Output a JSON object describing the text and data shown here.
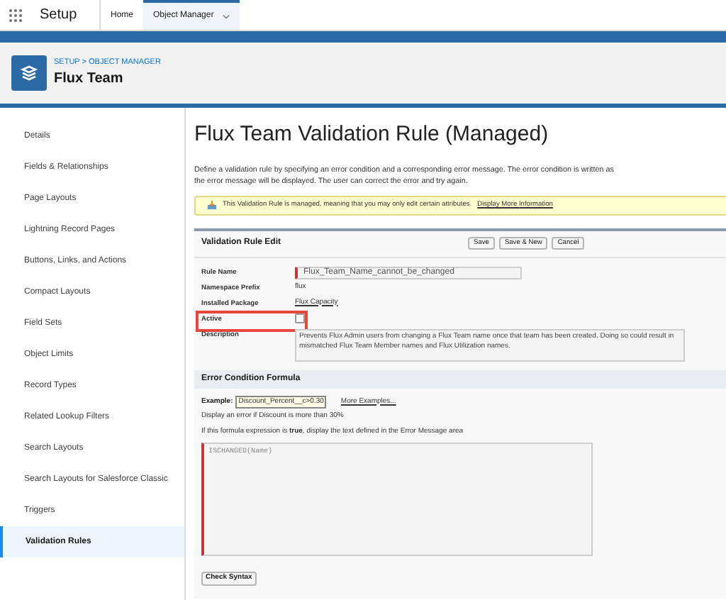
{
  "top_bar": {
    "app_name": "Setup",
    "tabs": [
      {
        "label": "Home",
        "selected": false
      },
      {
        "label": "Object Manager",
        "selected": true,
        "has_menu": true
      }
    ]
  },
  "header": {
    "breadcrumb": "SETUP > OBJECT MANAGER",
    "title": "Flux Team"
  },
  "sidebar": {
    "items": [
      {
        "label": "Details",
        "selected": false
      },
      {
        "label": "Fields & Relationships",
        "selected": false
      },
      {
        "label": "Page Layouts",
        "selected": false
      },
      {
        "label": "Lightning Record Pages",
        "selected": false
      },
      {
        "label": "Buttons, Links, and Actions",
        "selected": false
      },
      {
        "label": "Compact Layouts",
        "selected": false
      },
      {
        "label": "Field Sets",
        "selected": false
      },
      {
        "label": "Object Limits",
        "selected": false
      },
      {
        "label": "Record Types",
        "selected": false
      },
      {
        "label": "Related Lookup Filters",
        "selected": false
      },
      {
        "label": "Search Layouts",
        "selected": false
      },
      {
        "label": "Search Layouts for Salesforce Classic",
        "selected": false
      },
      {
        "label": "Triggers",
        "selected": false
      },
      {
        "label": "Validation Rules",
        "selected": true
      }
    ]
  },
  "page": {
    "title": "Flux Team Validation Rule (Managed)",
    "description_lines": [
      "Define a validation rule by specifying an error condition and a corresponding error message. The error condition is written as",
      "the error message will be displayed. The user can correct the error and try again."
    ],
    "notice": {
      "text": "This Validation Rule is managed, meaning that you may only edit certain attributes.",
      "link": "Display More Information"
    },
    "edit_panel": {
      "title": "Validation Rule Edit",
      "buttons": [
        "Save",
        "Save & New",
        "Cancel"
      ],
      "fields": [
        {
          "label": "Rule Name",
          "kind": "input",
          "value": "Flux_Team_Name_cannot_be_changed",
          "required": true
        },
        {
          "label": "Namespace Prefix",
          "kind": "text",
          "value": "flux"
        },
        {
          "label": "Installed Package",
          "kind": "link",
          "value": "Flux Capacity"
        },
        {
          "label": "Active",
          "kind": "checkbox",
          "checked": false,
          "highlighted": true
        },
        {
          "label": "Description",
          "kind": "textarea",
          "value": "Prevents Flux Admin users from changing a Flux Team name once that team has been created. Doing so could result in mismatched Flux Team Member names and Flux Utilization names."
        }
      ]
    },
    "formula_section": {
      "title": "Error Condition Formula",
      "example_label": "Example:",
      "example_value": "Discount_Percent__c>0.30",
      "more_examples": "More Examples...",
      "example_note": "Display an error if Discount is more than 30%",
      "hint": "If this formula expression is **true**, display the text defined in the Error Message area",
      "formula": "ISCHANGED(Name)",
      "check_button": "Check Syntax"
    }
  }
}
